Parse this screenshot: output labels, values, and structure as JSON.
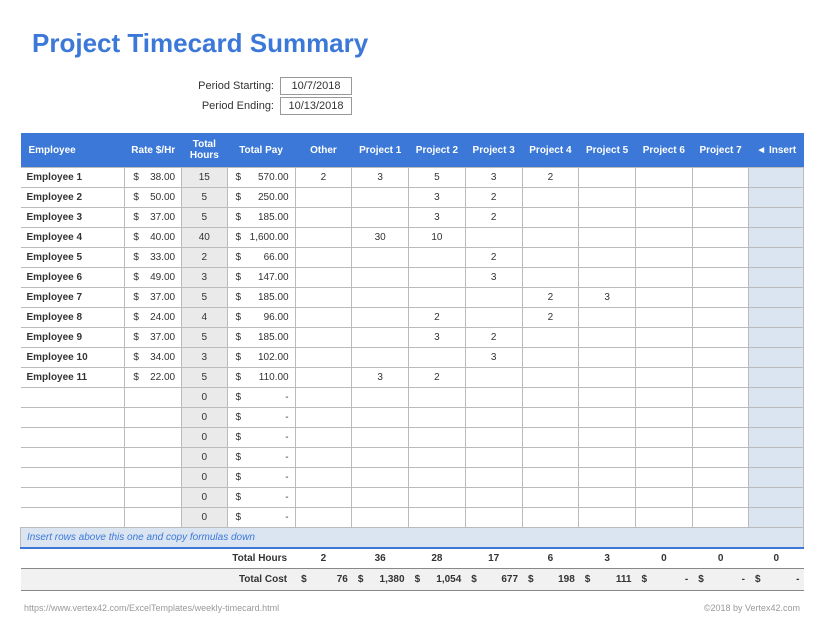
{
  "title": "Project Timecard Summary",
  "period": {
    "start_label": "Period Starting:",
    "start_value": "10/7/2018",
    "end_label": "Period Ending:",
    "end_value": "10/13/2018"
  },
  "headers": {
    "employee": "Employee",
    "rate": "Rate $/Hr",
    "total_hours": "Total Hours",
    "total_pay": "Total Pay",
    "other": "Other",
    "p1": "Project 1",
    "p2": "Project 2",
    "p3": "Project 3",
    "p4": "Project 4",
    "p5": "Project 5",
    "p6": "Project 6",
    "p7": "Project 7",
    "insert": "◄ Insert"
  },
  "rows": [
    {
      "emp": "Employee 1",
      "rate": "38.00",
      "hours": "15",
      "pay": "570.00",
      "other": "2",
      "p1": "3",
      "p2": "5",
      "p3": "3",
      "p4": "2",
      "p5": "",
      "p6": "",
      "p7": ""
    },
    {
      "emp": "Employee 2",
      "rate": "50.00",
      "hours": "5",
      "pay": "250.00",
      "other": "",
      "p1": "",
      "p2": "3",
      "p3": "2",
      "p4": "",
      "p5": "",
      "p6": "",
      "p7": ""
    },
    {
      "emp": "Employee 3",
      "rate": "37.00",
      "hours": "5",
      "pay": "185.00",
      "other": "",
      "p1": "",
      "p2": "3",
      "p3": "2",
      "p4": "",
      "p5": "",
      "p6": "",
      "p7": ""
    },
    {
      "emp": "Employee 4",
      "rate": "40.00",
      "hours": "40",
      "pay": "1,600.00",
      "other": "",
      "p1": "30",
      "p2": "10",
      "p3": "",
      "p4": "",
      "p5": "",
      "p6": "",
      "p7": ""
    },
    {
      "emp": "Employee 5",
      "rate": "33.00",
      "hours": "2",
      "pay": "66.00",
      "other": "",
      "p1": "",
      "p2": "",
      "p3": "2",
      "p4": "",
      "p5": "",
      "p6": "",
      "p7": ""
    },
    {
      "emp": "Employee 6",
      "rate": "49.00",
      "hours": "3",
      "pay": "147.00",
      "other": "",
      "p1": "",
      "p2": "",
      "p3": "3",
      "p4": "",
      "p5": "",
      "p6": "",
      "p7": ""
    },
    {
      "emp": "Employee 7",
      "rate": "37.00",
      "hours": "5",
      "pay": "185.00",
      "other": "",
      "p1": "",
      "p2": "",
      "p3": "",
      "p4": "2",
      "p5": "3",
      "p6": "",
      "p7": ""
    },
    {
      "emp": "Employee 8",
      "rate": "24.00",
      "hours": "4",
      "pay": "96.00",
      "other": "",
      "p1": "",
      "p2": "2",
      "p3": "",
      "p4": "2",
      "p5": "",
      "p6": "",
      "p7": ""
    },
    {
      "emp": "Employee 9",
      "rate": "37.00",
      "hours": "5",
      "pay": "185.00",
      "other": "",
      "p1": "",
      "p2": "3",
      "p3": "2",
      "p4": "",
      "p5": "",
      "p6": "",
      "p7": ""
    },
    {
      "emp": "Employee 10",
      "rate": "34.00",
      "hours": "3",
      "pay": "102.00",
      "other": "",
      "p1": "",
      "p2": "",
      "p3": "3",
      "p4": "",
      "p5": "",
      "p6": "",
      "p7": ""
    },
    {
      "emp": "Employee 11",
      "rate": "22.00",
      "hours": "5",
      "pay": "110.00",
      "other": "",
      "p1": "3",
      "p2": "2",
      "p3": "",
      "p4": "",
      "p5": "",
      "p6": "",
      "p7": ""
    },
    {
      "emp": "",
      "rate": "",
      "hours": "0",
      "pay": "-",
      "other": "",
      "p1": "",
      "p2": "",
      "p3": "",
      "p4": "",
      "p5": "",
      "p6": "",
      "p7": ""
    },
    {
      "emp": "",
      "rate": "",
      "hours": "0",
      "pay": "-",
      "other": "",
      "p1": "",
      "p2": "",
      "p3": "",
      "p4": "",
      "p5": "",
      "p6": "",
      "p7": ""
    },
    {
      "emp": "",
      "rate": "",
      "hours": "0",
      "pay": "-",
      "other": "",
      "p1": "",
      "p2": "",
      "p3": "",
      "p4": "",
      "p5": "",
      "p6": "",
      "p7": ""
    },
    {
      "emp": "",
      "rate": "",
      "hours": "0",
      "pay": "-",
      "other": "",
      "p1": "",
      "p2": "",
      "p3": "",
      "p4": "",
      "p5": "",
      "p6": "",
      "p7": ""
    },
    {
      "emp": "",
      "rate": "",
      "hours": "0",
      "pay": "-",
      "other": "",
      "p1": "",
      "p2": "",
      "p3": "",
      "p4": "",
      "p5": "",
      "p6": "",
      "p7": ""
    },
    {
      "emp": "",
      "rate": "",
      "hours": "0",
      "pay": "-",
      "other": "",
      "p1": "",
      "p2": "",
      "p3": "",
      "p4": "",
      "p5": "",
      "p6": "",
      "p7": ""
    },
    {
      "emp": "",
      "rate": "",
      "hours": "0",
      "pay": "-",
      "other": "",
      "p1": "",
      "p2": "",
      "p3": "",
      "p4": "",
      "p5": "",
      "p6": "",
      "p7": ""
    }
  ],
  "note": "Insert rows above this one and copy formulas down",
  "totals": {
    "hours_label": "Total Hours",
    "cost_label": "Total Cost",
    "other_hours": "2",
    "p1_hours": "36",
    "p2_hours": "28",
    "p3_hours": "17",
    "p4_hours": "6",
    "p5_hours": "3",
    "p6_hours": "0",
    "p7_hours": "0",
    "insert_hours": "0",
    "other_cost": "76",
    "p1_cost": "1,380",
    "p2_cost": "1,054",
    "p3_cost": "677",
    "p4_cost": "198",
    "p5_cost": "111",
    "p6_cost": "-",
    "p7_cost": "-",
    "insert_cost": "-"
  },
  "footer": {
    "left": "https://www.vertex42.com/ExcelTemplates/weekly-timecard.html",
    "right": "©2018 by Vertex42.com"
  },
  "chart_data": {
    "type": "table",
    "title": "Project Timecard Summary",
    "period_start": "10/7/2018",
    "period_end": "10/13/2018",
    "columns": [
      "Employee",
      "Rate $/Hr",
      "Total Hours",
      "Total Pay",
      "Other",
      "Project 1",
      "Project 2",
      "Project 3",
      "Project 4",
      "Project 5",
      "Project 6",
      "Project 7"
    ],
    "employee_rows": [
      [
        "Employee 1",
        38.0,
        15,
        570.0,
        2,
        3,
        5,
        3,
        2,
        null,
        null,
        null
      ],
      [
        "Employee 2",
        50.0,
        5,
        250.0,
        null,
        null,
        3,
        2,
        null,
        null,
        null,
        null
      ],
      [
        "Employee 3",
        37.0,
        5,
        185.0,
        null,
        null,
        3,
        2,
        null,
        null,
        null,
        null
      ],
      [
        "Employee 4",
        40.0,
        40,
        1600.0,
        null,
        30,
        10,
        null,
        null,
        null,
        null,
        null
      ],
      [
        "Employee 5",
        33.0,
        2,
        66.0,
        null,
        null,
        null,
        2,
        null,
        null,
        null,
        null
      ],
      [
        "Employee 6",
        49.0,
        3,
        147.0,
        null,
        null,
        null,
        3,
        null,
        null,
        null,
        null
      ],
      [
        "Employee 7",
        37.0,
        5,
        185.0,
        null,
        null,
        null,
        null,
        2,
        3,
        null,
        null
      ],
      [
        "Employee 8",
        24.0,
        4,
        96.0,
        null,
        null,
        2,
        null,
        2,
        null,
        null,
        null
      ],
      [
        "Employee 9",
        37.0,
        5,
        185.0,
        null,
        null,
        3,
        2,
        null,
        null,
        null,
        null
      ],
      [
        "Employee 10",
        34.0,
        3,
        102.0,
        null,
        null,
        null,
        3,
        null,
        null,
        null,
        null
      ],
      [
        "Employee 11",
        22.0,
        5,
        110.0,
        null,
        3,
        2,
        null,
        null,
        null,
        null,
        null
      ]
    ],
    "total_hours_by_project": {
      "Other": 2,
      "Project 1": 36,
      "Project 2": 28,
      "Project 3": 17,
      "Project 4": 6,
      "Project 5": 3,
      "Project 6": 0,
      "Project 7": 0
    },
    "total_cost_by_project": {
      "Other": 76,
      "Project 1": 1380,
      "Project 2": 1054,
      "Project 3": 677,
      "Project 4": 198,
      "Project 5": 111,
      "Project 6": 0,
      "Project 7": 0
    }
  }
}
